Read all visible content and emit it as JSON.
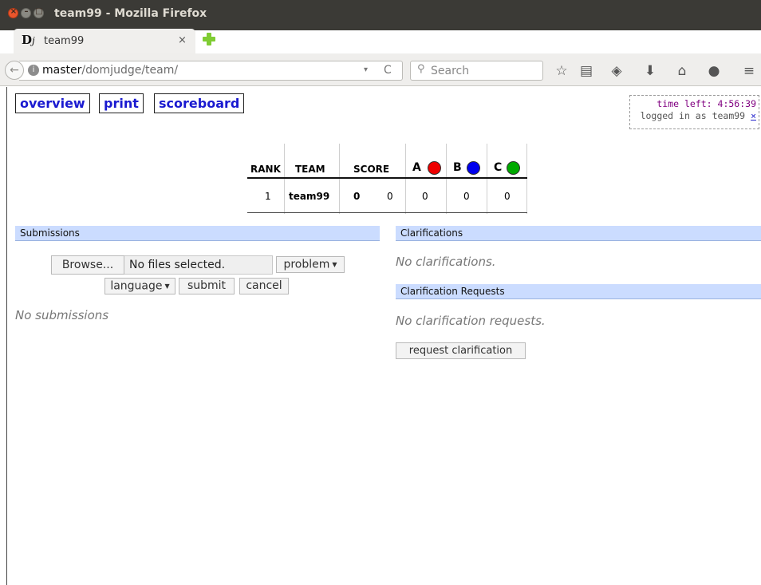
{
  "window": {
    "title": "team99 - Mozilla Firefox",
    "close_glyph": "×",
    "min_glyph": "–",
    "max_glyph": "□"
  },
  "tab": {
    "favicon_letter": "D",
    "favicon_sub": "j",
    "title": "team99",
    "close_glyph": "×"
  },
  "navbar": {
    "back_glyph": "←",
    "url_host": "master",
    "url_path": "/domjudge/team/",
    "url_dropdown_glyph": "▾",
    "reload_glyph": "C",
    "search_placeholder": "Search",
    "icons": [
      "star-icon",
      "reading-list-icon",
      "pocket-icon",
      "download-icon",
      "home-icon",
      "chat-icon",
      "menu-icon"
    ],
    "icon_glyphs": [
      "☆",
      "▤",
      "◈",
      "⬇",
      "⌂",
      "●",
      "≡"
    ]
  },
  "menu": {
    "overview": "overview",
    "print": "print",
    "scoreboard": "scoreboard"
  },
  "clock": {
    "time_left": "time left: 4:56:39",
    "logged_in": "logged in as team99",
    "logout": "×"
  },
  "scoreboard": {
    "headers": {
      "rank": "RANK",
      "team": "TEAM",
      "score": "SCORE"
    },
    "problems": [
      {
        "label": "A",
        "color": "#ee0000"
      },
      {
        "label": "B",
        "color": "#0000ee"
      },
      {
        "label": "C",
        "color": "#00aa00"
      }
    ],
    "row": {
      "rank": "1",
      "team": "team99",
      "solved": "0",
      "time": "0",
      "results": [
        "0",
        "0",
        "0"
      ]
    }
  },
  "submissions": {
    "header": "Submissions",
    "browse_label": "Browse...",
    "file_status": "No files selected.",
    "problem_select": "problem",
    "language_select": "language",
    "submit_label": "submit",
    "cancel_label": "cancel",
    "empty_note": "No submissions"
  },
  "clarifications": {
    "header": "Clarifications",
    "empty_note": "No clarifications.",
    "requests_header": "Clarification Requests",
    "requests_empty_note": "No clarification requests.",
    "request_button": "request clarification"
  }
}
